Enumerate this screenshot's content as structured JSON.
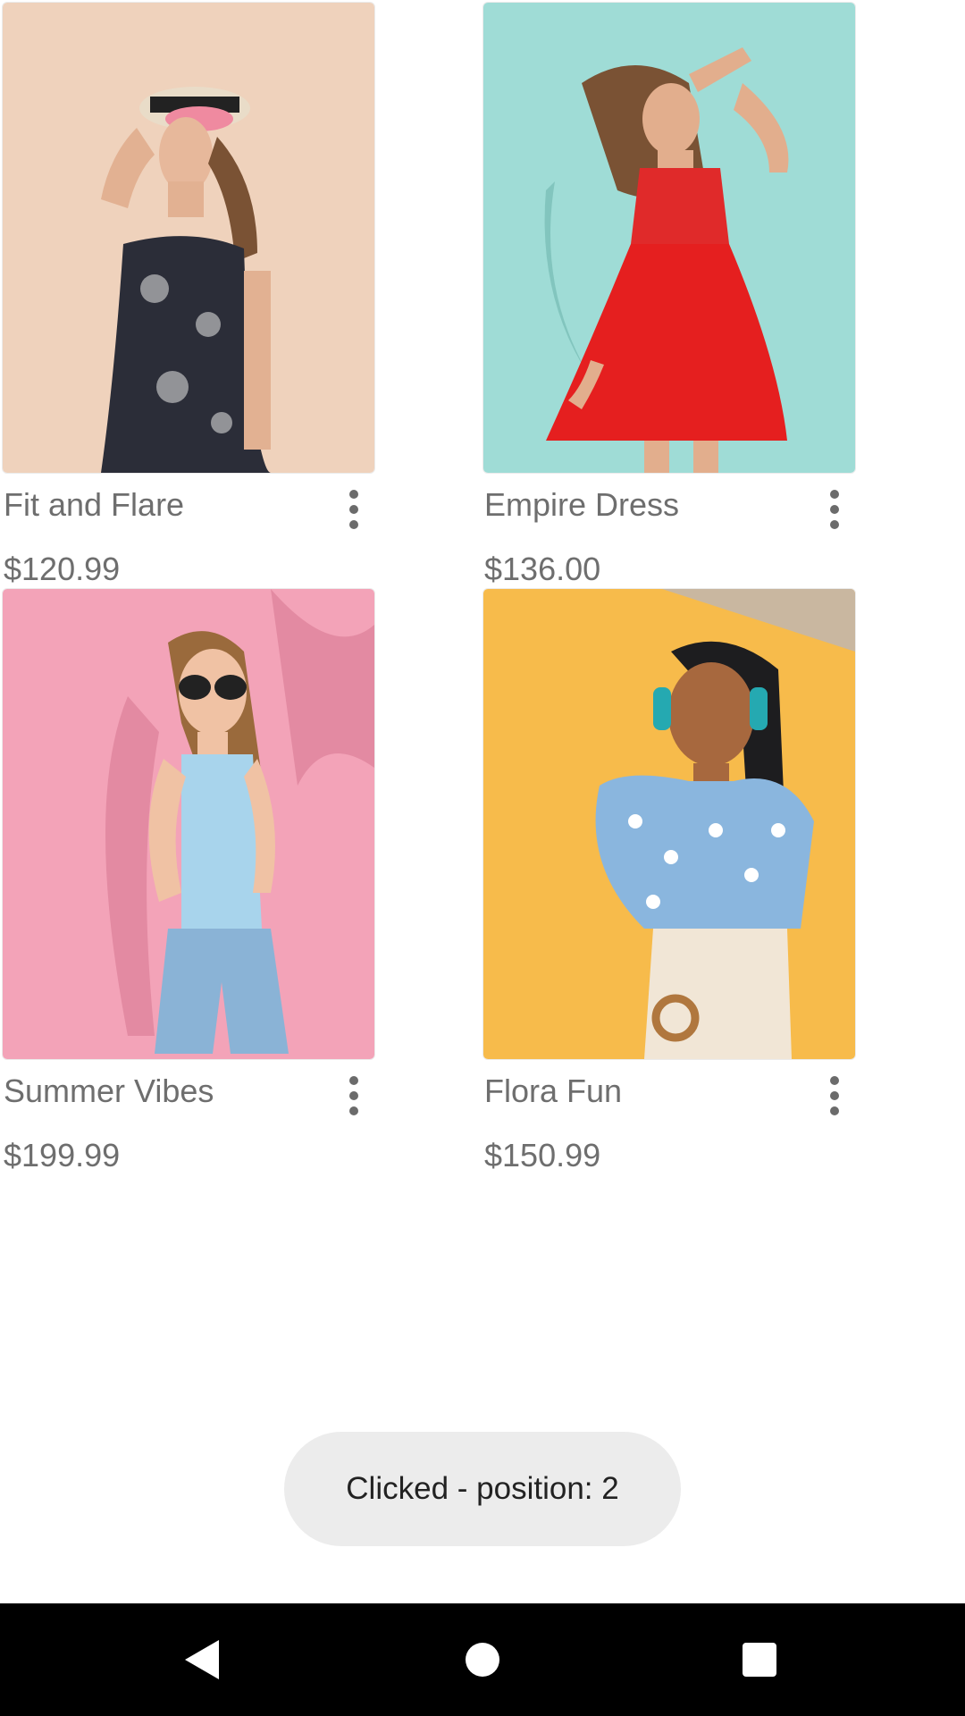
{
  "products": [
    {
      "title": "Fit and Flare",
      "price": "$120.99",
      "image": "woman-in-floral-strapless-dress-and-hat",
      "bg": "#efd2bc"
    },
    {
      "title": "Empire Dress",
      "price": "$136.00",
      "image": "woman-in-red-dress-dancing",
      "bg": "#9fdcd6"
    },
    {
      "title": "Summer Vibes",
      "price": "$199.99",
      "image": "woman-in-sunglasses-and-denim-shorts",
      "bg": "#f3a3b8"
    },
    {
      "title": "Flora Fun",
      "price": "$150.99",
      "image": "woman-with-headphones-floral-top",
      "bg": "#f7bb4b"
    }
  ],
  "toast": {
    "text": "Clicked - position: 2"
  },
  "navbar": {
    "back_icon": "back-triangle-icon",
    "home_icon": "home-circle-icon",
    "recents_icon": "recents-square-icon"
  }
}
